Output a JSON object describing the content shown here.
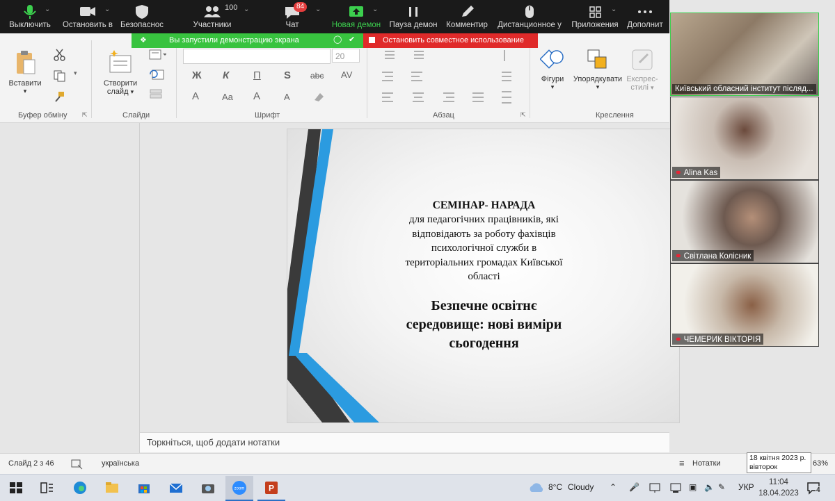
{
  "zoom_toolbar": {
    "mute": "Выключить",
    "stop_video": "Остановить в",
    "security": "Безопаснос",
    "participants": "Участники",
    "participants_count": "100",
    "chat": "Чат",
    "chat_badge": "84",
    "new_share": "Новая демон",
    "pause_share": "Пауза демон",
    "annotate": "Комментир",
    "remote_control": "Дистанционное у",
    "apps": "Приложения",
    "more": "Дополнит"
  },
  "share_banner": {
    "green_text": "Вы запустили демонстрацию экрана",
    "red_text": "Остановить совместное использование"
  },
  "ribbon": {
    "paste": "Вставити",
    "clipboard_group": "Буфер обміну",
    "new_slide_line1": "Створити",
    "new_slide_line2": "слайд",
    "slides_group": "Слайди",
    "font_size": "20",
    "font_group": "Шрифт",
    "bold": "Ж",
    "italic": "К",
    "underline": "П",
    "shadow": "S",
    "strike": "abc",
    "spacing": "AV",
    "font_color_a": "A",
    "case": "Aa",
    "grow": "A",
    "shrink": "A",
    "paragraph_group": "Абзац",
    "shapes": "Фігури",
    "arrange": "Упорядкувати",
    "quick_styles_line1": "Експрес-",
    "quick_styles_line2": "стилі",
    "drawing_group": "Креслення"
  },
  "slide": {
    "heading": "СЕМІНАР- НАРАДА",
    "subtitle_lines": [
      "для педагогічних працівників, які",
      "відповідають за роботу фахівців",
      "психологічної служби в",
      "територіальних громадах  Київської",
      "області"
    ],
    "title_lines": [
      "Безпечне освітнє",
      "середовище: нові виміри",
      "сьогодення"
    ]
  },
  "notes_placeholder": "Торкніться, щоб додати нотатки",
  "status": {
    "slide_index": "Слайд 2 з 46",
    "language": "українська",
    "notes": "Нотатки",
    "zoom": "63%"
  },
  "participants_panel": [
    {
      "name": "Київський обласний інститут післяд...",
      "muted": false
    },
    {
      "name": "Alina Kas",
      "muted": true
    },
    {
      "name": "Світлана Колісник",
      "muted": true
    },
    {
      "name": "ЧЕМЕРИК ВІКТОРІЯ",
      "muted": true
    }
  ],
  "tooltip": {
    "date": "18 квітня 2023 р.",
    "weekday": "вівторок"
  },
  "taskbar": {
    "weather_temp": "8°C",
    "weather_desc": "Cloudy",
    "lang": "УКР",
    "time": "11:04",
    "date": "18.04.2023",
    "notif_count": "4",
    "apps": [
      "start-icon",
      "task-view-icon",
      "edge-icon",
      "file-explorer-icon",
      "store-icon",
      "mail-icon",
      "camera-icon",
      "zoom-icon",
      "powerpoint-icon"
    ]
  },
  "colors": {
    "zoom_bg": "#1a1a1a",
    "share_green": "#38c33f",
    "share_red": "#e02a2a",
    "slide_blue": "#2b9be0",
    "slide_dark": "#3a3a3a"
  }
}
